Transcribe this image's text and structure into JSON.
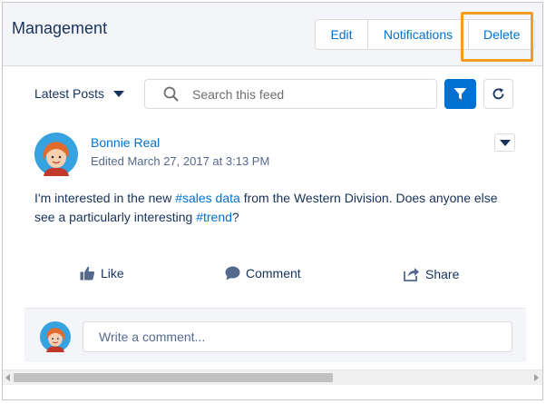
{
  "header": {
    "title": "Management",
    "buttons": {
      "edit": "Edit",
      "notifications": "Notifications",
      "delete": "Delete"
    }
  },
  "toolbar": {
    "sort_label": "Latest Posts",
    "search_placeholder": "Search this feed"
  },
  "post": {
    "author": "Bonnie Real",
    "meta": "Edited March 27, 2017 at 3:13 PM",
    "body": {
      "part1": "I'm interested in the new ",
      "tag1": "#sales data",
      "part2": " from the Western Division. Does anyone else see a particularly interesting ",
      "tag2": "#trend",
      "part3": "?"
    },
    "actions": {
      "like": "Like",
      "comment": "Comment",
      "share": "Share"
    }
  },
  "comment": {
    "placeholder": "Write a comment..."
  },
  "colors": {
    "accent": "#0070d2",
    "highlight": "#f39c1f",
    "text": "#16325c",
    "header_bg": "#f3f5f8"
  },
  "icons": [
    "search-icon",
    "filter-icon",
    "refresh-icon",
    "like-icon",
    "comment-icon",
    "share-icon",
    "chevron-down-icon"
  ]
}
